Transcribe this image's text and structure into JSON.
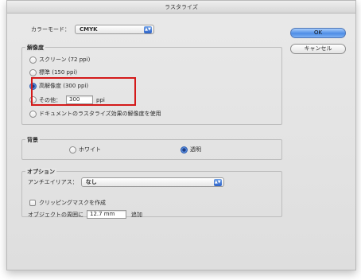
{
  "window": {
    "title": "ラスタライズ"
  },
  "color_mode": {
    "label": "カラーモード：",
    "value": "CMYK"
  },
  "resolution": {
    "title": "解像度",
    "options": [
      {
        "label": "スクリーン (72 ppi)",
        "selected": false
      },
      {
        "label": "標準 (150 ppi)",
        "selected": false
      },
      {
        "label": "高解像度 (300 ppi)",
        "selected": true
      },
      {
        "label": "その他：",
        "selected": false
      },
      {
        "label": "ドキュメントのラスタライズ効果の解像度を使用",
        "selected": false
      }
    ],
    "other_value": "300",
    "other_unit": "ppi"
  },
  "background": {
    "title": "背景",
    "white_label": "ホワイト",
    "transparent_label": "透明",
    "selected": "transparent"
  },
  "options": {
    "title": "オプション",
    "antialias_label": "アンチエイリアス：",
    "antialias_value": "なし",
    "clipping_mask_label": "クリッピングマスクを作成",
    "clipping_mask_checked": false,
    "around_label": "オブジェクトの周囲に",
    "around_value": "12.7 mm",
    "around_suffix": "追加"
  },
  "buttons": {
    "ok": "OK",
    "cancel": "キャンセル"
  },
  "colors": {
    "highlight": "#d41a1a",
    "accent": "#4d8de6"
  }
}
